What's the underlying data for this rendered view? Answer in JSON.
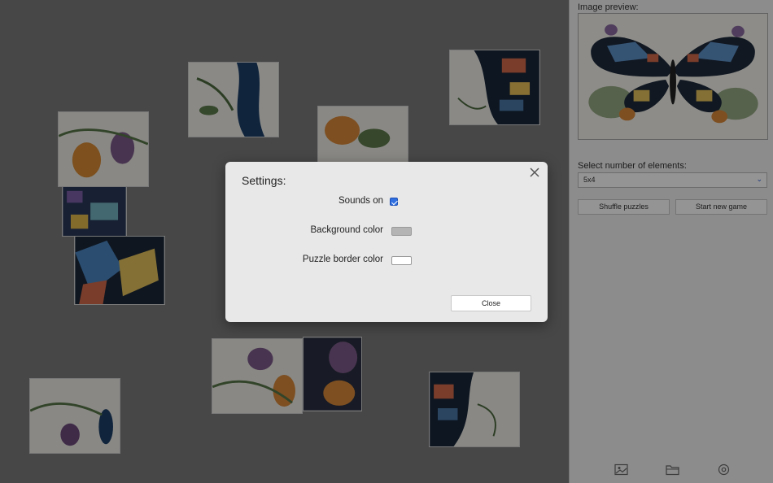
{
  "sidebar": {
    "preview_label": "Image preview:",
    "select_label": "Select number of elements:",
    "select_value": "5x4",
    "shuffle_label": "Shuffle puzzles",
    "new_game_label": "Start new game",
    "toolbar_icons": [
      "image-icon",
      "folder-icon",
      "settings-icon"
    ]
  },
  "modal": {
    "title": "Settings:",
    "sounds_label": "Sounds on",
    "sounds_on": true,
    "background_label": "Background color",
    "background_color": "#b4b4b4",
    "border_label": "Puzzle border color",
    "border_color": "#ffffff",
    "close_label": "Close"
  },
  "colors": {
    "board_background": "#7a7a7a",
    "sidebar_background": "#f1f1f1",
    "accent": "#2f6fe0"
  }
}
